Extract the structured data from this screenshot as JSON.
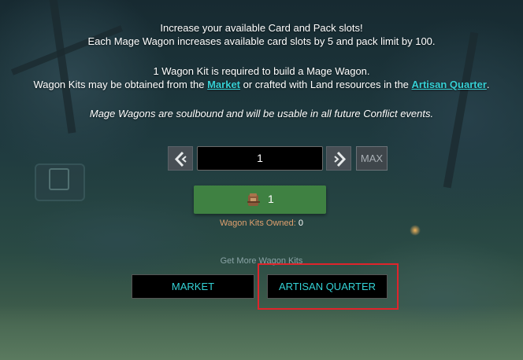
{
  "info": {
    "line1": "Increase your available Card and Pack slots!",
    "line2": "Each Mage Wagon increases available card slots by 5 and pack limit by 100.",
    "line3": "1 Wagon Kit is required to build a Mage Wagon.",
    "line4_prefix": "Wagon Kits may be obtained from the ",
    "market_link": "Market",
    "line4_middle": " or crafted with Land resources in the ",
    "artisan_link": "Artisan Quarter",
    "line4_suffix": ".",
    "line5": "Mage Wagons are soulbound and will be usable in all future Conflict events."
  },
  "quantity": {
    "value": "1",
    "decrement_icon": "chevron-left-icon",
    "increment_icon": "chevron-right-icon",
    "max_label": "MAX"
  },
  "buy_button": {
    "icon": "wagon-kit-icon",
    "count": "1",
    "color": "#3f8142"
  },
  "owned": {
    "label": "Wagon Kits Owned:",
    "value": "0"
  },
  "get_more": {
    "label": "Get More Wagon Kits",
    "market_button": "MARKET",
    "artisan_button": "ARTISAN QUARTER"
  },
  "colors": {
    "accent_link": "#36d0d5",
    "highlight": "#e0242b",
    "owned_label": "#e0a06e"
  }
}
